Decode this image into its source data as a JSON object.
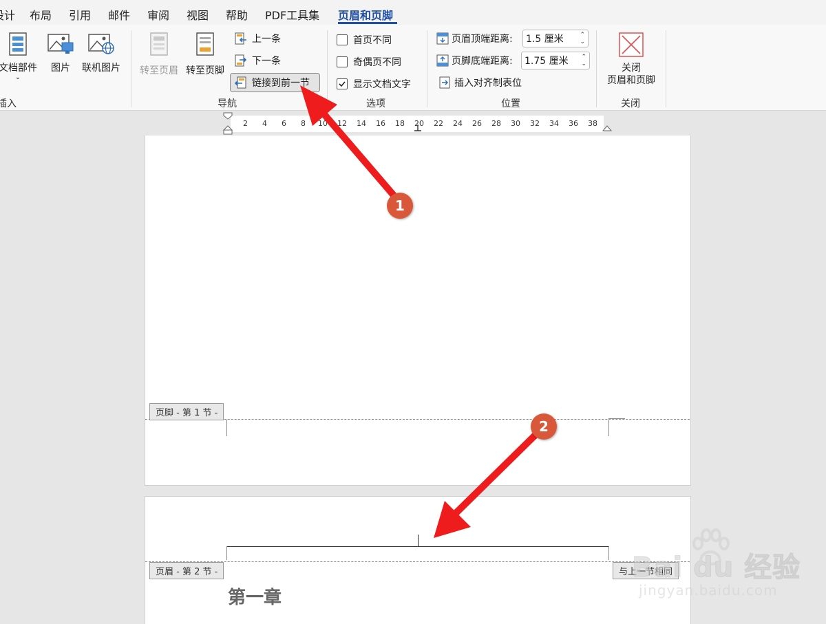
{
  "menu": {
    "tabs": [
      "设计",
      "布局",
      "引用",
      "邮件",
      "审阅",
      "视图",
      "帮助",
      "PDF工具集",
      "页眉和页脚"
    ],
    "active_tab": "页眉和页脚"
  },
  "ribbon": {
    "insert_group": {
      "doc_parts": "文档部件",
      "picture": "图片",
      "online_picture": "联机图片",
      "label": "插入"
    },
    "nav_group": {
      "goto_header": "转至页眉",
      "goto_footer": "转至页脚",
      "previous": "上一条",
      "next": "下一条",
      "link_previous": "链接到前一节",
      "label": "导航"
    },
    "options_group": {
      "first_page_diff": "首页不同",
      "odd_even_diff": "奇偶页不同",
      "show_doc_text": "显示文档文字",
      "label": "选项",
      "first_page_checked": false,
      "odd_even_checked": false,
      "show_doc_text_checked": true
    },
    "position_group": {
      "header_top_label": "页眉顶端距离:",
      "header_top_value": "1.5 厘米",
      "footer_bottom_label": "页脚底端距离:",
      "footer_bottom_value": "1.75 厘米",
      "insert_align_tab": "插入对齐制表位",
      "label": "位置"
    },
    "close_group": {
      "close_line1": "关闭",
      "close_line2": "页眉和页脚",
      "label": "关闭"
    }
  },
  "ruler": {
    "ticks": [
      "2",
      "4",
      "6",
      "8",
      "10",
      "12",
      "14",
      "16",
      "18",
      "20",
      "22",
      "24",
      "26",
      "28",
      "30",
      "32",
      "34",
      "36",
      "38"
    ]
  },
  "document": {
    "footer_label_section1": "页脚 - 第 1 节 -",
    "header_label_section2": "页眉 - 第 2 节 -",
    "same_as_previous": "与上一节相同",
    "chapter_title": "第一章"
  },
  "annotations": {
    "step1": "1",
    "step2": "2",
    "arrow_color": "#ee1c1c",
    "bubble_color": "#d9583a"
  },
  "watermark": {
    "text": "Bai du 经验",
    "url": "jingyan.baidu.com"
  },
  "colors": {
    "accent": "#1e4fa1"
  }
}
